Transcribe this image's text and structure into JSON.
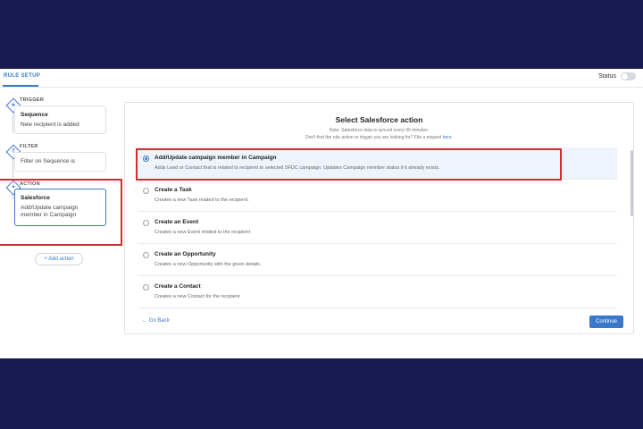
{
  "header": {
    "tab_label": "RULE SETUP",
    "status_label": "Status"
  },
  "flow": {
    "trigger": {
      "label": "TRIGGER",
      "icon": "star-icon",
      "icon_glyph": "★",
      "title": "Sequence",
      "desc": "New recipient is added"
    },
    "filter": {
      "label": "FILTER",
      "icon": "filter-icon",
      "icon_glyph": "T",
      "desc": "Filter on Sequence is"
    },
    "action": {
      "label": "ACTION",
      "icon": "action-icon",
      "icon_glyph": "✦",
      "title": "Salesforce",
      "desc": "Add/Update campaign member in Campaign"
    },
    "add_action": "+ Add action"
  },
  "panel": {
    "title": "Select Salesforce action",
    "note": "Note: Salesforce data is synced every 30 minutes.",
    "request_text": "Don't find the rule action or trigger you are looking for? File a request",
    "request_link": "here.",
    "options": [
      {
        "title": "Add/Update campaign member in Campaign",
        "desc": "Adds Lead or Contact that is related to recipient to selected SFDC campaign. Updates Campaign member status if it already exists.",
        "selected": true
      },
      {
        "title": "Create a Task",
        "desc": "Creates a new Task related to the recipient.",
        "selected": false
      },
      {
        "title": "Create an Event",
        "desc": "Creates a new Event related to the recipient",
        "selected": false
      },
      {
        "title": "Create an Opportunity",
        "desc": "Creates a new Opportunity with the given details.",
        "selected": false
      },
      {
        "title": "Create a Contact",
        "desc": "Creates a new Contact for the recipient",
        "selected": false
      }
    ],
    "go_back": "← Go Back",
    "continue": "Continue"
  },
  "colors": {
    "backdrop": "#1a1a52",
    "accent": "#3a78c9",
    "highlight": "#d62b2b"
  }
}
